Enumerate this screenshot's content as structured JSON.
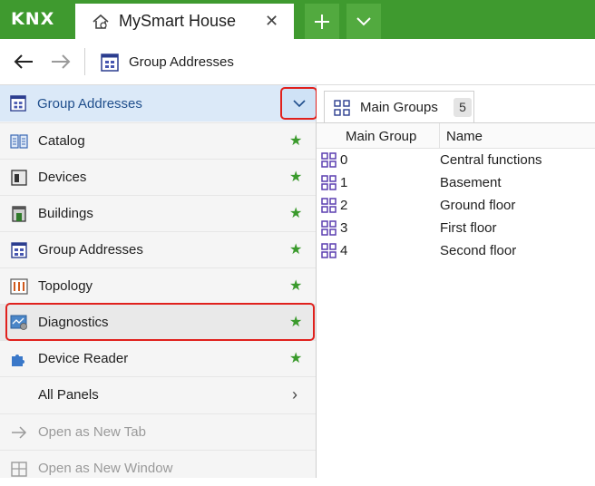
{
  "app": {
    "logo": "KNX",
    "tab_title": "MySmart House",
    "accent": "#3f9a2f",
    "highlight": "#e0211d"
  },
  "toolbar": {
    "back_icon": "arrow-left-icon",
    "forward_icon": "arrow-right-icon",
    "title": "Group Addresses"
  },
  "left_panel": {
    "header": "Group Addresses",
    "items": [
      {
        "label": "Catalog",
        "icon": "catalog-icon",
        "starred": true
      },
      {
        "label": "Devices",
        "icon": "devices-icon",
        "starred": true
      },
      {
        "label": "Buildings",
        "icon": "buildings-icon",
        "starred": true
      },
      {
        "label": "Group Addresses",
        "icon": "group-addresses-icon",
        "starred": true
      },
      {
        "label": "Topology",
        "icon": "topology-icon",
        "starred": true
      },
      {
        "label": "Diagnostics",
        "icon": "diagnostics-icon",
        "starred": true
      },
      {
        "label": "Device Reader",
        "icon": "device-reader-icon",
        "starred": true
      },
      {
        "label": "All Panels",
        "icon": "chevron-right-icon",
        "starred": false
      },
      {
        "label": "Open as New Tab",
        "icon": "arrow-right-icon",
        "starred": false
      },
      {
        "label": "Open as New Window",
        "icon": "window-icon",
        "starred": false
      }
    ]
  },
  "content": {
    "tab_label": "Main Groups",
    "tab_count": "5",
    "columns": [
      "Main Group",
      "Name"
    ],
    "rows": [
      {
        "id": "0",
        "name": "Central functions"
      },
      {
        "id": "1",
        "name": "Basement"
      },
      {
        "id": "2",
        "name": "Ground floor"
      },
      {
        "id": "3",
        "name": "First floor"
      },
      {
        "id": "4",
        "name": "Second floor"
      }
    ]
  }
}
